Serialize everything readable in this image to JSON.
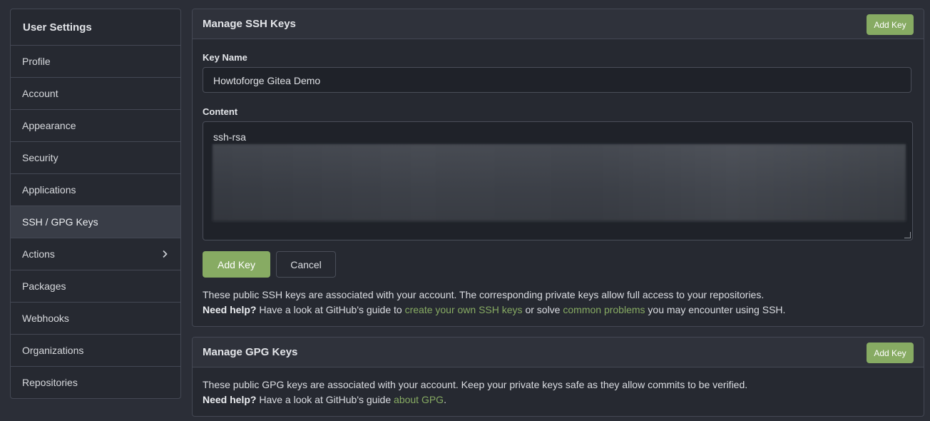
{
  "sidebar": {
    "title": "User Settings",
    "items": [
      {
        "label": "Profile"
      },
      {
        "label": "Account"
      },
      {
        "label": "Appearance"
      },
      {
        "label": "Security"
      },
      {
        "label": "Applications"
      },
      {
        "label": "SSH / GPG Keys",
        "active": true
      },
      {
        "label": "Actions",
        "expandable": true
      },
      {
        "label": "Packages"
      },
      {
        "label": "Webhooks"
      },
      {
        "label": "Organizations"
      },
      {
        "label": "Repositories"
      }
    ]
  },
  "ssh": {
    "title": "Manage SSH Keys",
    "header_button": "Add Key",
    "key_name_label": "Key Name",
    "key_name_value": "Howtoforge Gitea Demo",
    "content_label": "Content",
    "content_first_line": "ssh-rsa",
    "add_button": "Add Key",
    "cancel_button": "Cancel",
    "info_text": "These public SSH keys are associated with your account. The corresponding private keys allow full access to your repositories.",
    "help_bold": "Need help?",
    "help_prefix": " Have a look at GitHub's guide to ",
    "help_link1": "create your own SSH keys",
    "help_middle": " or solve ",
    "help_link2": "common problems",
    "help_suffix": " you may encounter using SSH."
  },
  "gpg": {
    "title": "Manage GPG Keys",
    "header_button": "Add Key",
    "info_text": "These public GPG keys are associated with your account. Keep your private keys safe as they allow commits to be verified.",
    "help_bold": "Need help?",
    "help_prefix": " Have a look at GitHub's guide ",
    "help_link": "about GPG",
    "help_suffix": "."
  },
  "colors": {
    "background": "#2b2e37",
    "accent_green": "#87ab63",
    "panel": "#262931",
    "border": "#444854"
  }
}
